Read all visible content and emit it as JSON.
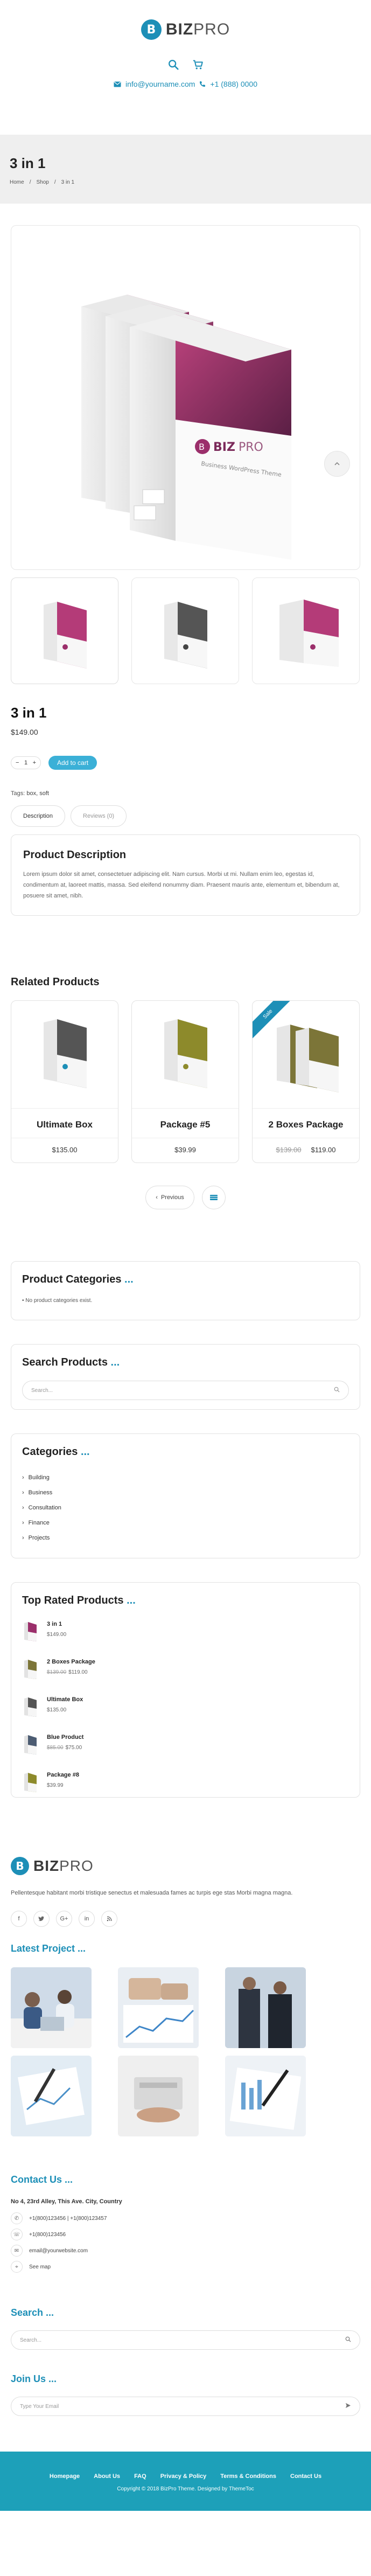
{
  "brand": {
    "logo_letter": "B",
    "logo_bold": "BIZ",
    "logo_light": "PRO"
  },
  "header": {
    "email": "info@yourname.com",
    "phone": "+1 (888) 0000"
  },
  "page": {
    "title": "3 in 1",
    "breadcrumb": [
      "Home",
      "Shop",
      "3 in 1"
    ]
  },
  "product": {
    "name": "3 in 1",
    "price": "$149.00",
    "qty": "1",
    "add_to_cart": "Add to cart",
    "tags_label": "Tags:",
    "tags": "box, soft",
    "tabs": [
      "Description",
      "Reviews (0)"
    ],
    "desc_title": "Product Description",
    "desc_text": "Lorem ipsum dolor sit amet, consectetuer adipiscing elit. Nam cursus. Morbi ut mi. Nullam enim leo, egestas id, condimentum at, laoreet mattis, massa. Sed eleifend nonummy diam. Praesent mauris ante, elementum et, bibendum at, posuere sit amet, nibh."
  },
  "related": {
    "title": "Related Products",
    "items": [
      {
        "name": "Ultimate Box",
        "price": "$135.00",
        "old": "",
        "color": "#555555",
        "sale": false
      },
      {
        "name": "Package #5",
        "price": "$39.99",
        "old": "",
        "color": "#8d8a2b",
        "sale": false
      },
      {
        "name": "2 Boxes Package",
        "price": "$119.00",
        "old": "$139.00",
        "color": "#7c7538",
        "sale": true
      }
    ],
    "sale_label": "Sale",
    "prev": "Previous"
  },
  "widgets": {
    "categories_title": "Product Categories",
    "categories_note": "No product categories exist.",
    "search_title": "Search Products",
    "search_placeholder": "Search...",
    "cat_title": "Categories",
    "cats": [
      "Building",
      "Business",
      "Consultation",
      "Finance",
      "Projects"
    ],
    "top_title": "Top Rated Products",
    "top": [
      {
        "name": "3 in 1",
        "price": "$149.00",
        "old": "",
        "color": "#9b2f6b"
      },
      {
        "name": "2 Boxes Package",
        "price": "$119.00",
        "old": "$139.00",
        "color": "#7c7538"
      },
      {
        "name": "Ultimate Box",
        "price": "$135.00",
        "old": "",
        "color": "#555555"
      },
      {
        "name": "Blue Product",
        "price": "$75.00",
        "old": "$85.00",
        "color": "#4c5c72"
      },
      {
        "name": "Package #8",
        "price": "$39.99",
        "old": "",
        "color": "#8d8a2b"
      }
    ],
    "dots": "..."
  },
  "footer": {
    "about": "Pellentesque habitant morbi tristique senectus et malesuada fames ac turpis ege stas Morbi magna magna.",
    "socials": [
      "f",
      "t",
      "G+",
      "in",
      "rss"
    ],
    "projects_title": "Latest Project ...",
    "contact_title": "Contact Us ...",
    "address": "No 4, 23rd Alley, This Ave. City, Country",
    "contacts": [
      "+1(800)123456  |  +1(800)123457",
      "+1(800)123456",
      "email@yourwebsite.com",
      "See map"
    ],
    "search_title": "Search ...",
    "search_placeholder": "Search...",
    "join_title": "Join Us ...",
    "join_placeholder": "Type Your Email",
    "nav": [
      "Homepage",
      "About Us",
      "FAQ",
      "Privacy & Policy",
      "Terms & Conditions",
      "Contact Us"
    ],
    "copyright": "Copyright © 2018 BizPro Theme. Designed by ThemeToc"
  },
  "colors": {
    "accent": "#1d8fb7",
    "button": "#3bb0d7",
    "footerbar": "#1da0b9"
  }
}
